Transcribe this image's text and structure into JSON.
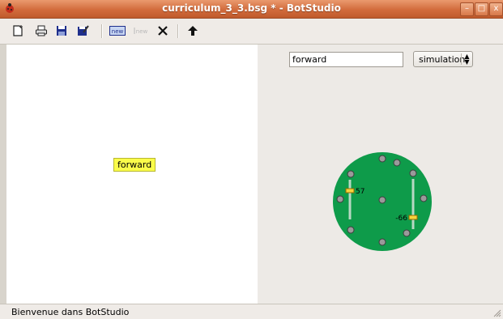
{
  "window": {
    "title": "curriculum_3_3.bsg * - BotStudio",
    "minimize_label": "–",
    "maximize_label": "□",
    "close_label": "x"
  },
  "toolbar": {
    "items": [
      {
        "name": "new-document-button",
        "icon": "new-document-icon"
      },
      {
        "name": "print-button",
        "icon": "printer-icon"
      },
      {
        "name": "save-button",
        "icon": "floppy-disk-icon"
      },
      {
        "name": "save-as-button",
        "icon": "floppy-edit-icon"
      },
      {
        "name": "new-state-button",
        "icon": "new-state-icon",
        "label": "new"
      },
      {
        "name": "new-transition-button",
        "icon": "new-transition-icon",
        "label": "new",
        "disabled": true
      },
      {
        "name": "delete-button",
        "icon": "delete-cross-icon"
      },
      {
        "name": "up-arrow-button",
        "icon": "up-arrow-icon"
      }
    ]
  },
  "editor": {
    "state_label": "forward"
  },
  "state_panel": {
    "name_value": "forward",
    "mode_value": "simulation",
    "robot": {
      "left_motor_value": "57",
      "right_motor_value": "-66",
      "left_motor_level": 0.57,
      "right_motor_level": -0.66,
      "body_color": "#0e9b4a",
      "sensor_color": "#9a9a9a"
    }
  },
  "statusbar": {
    "text": "Bienvenue dans BotStudio"
  }
}
